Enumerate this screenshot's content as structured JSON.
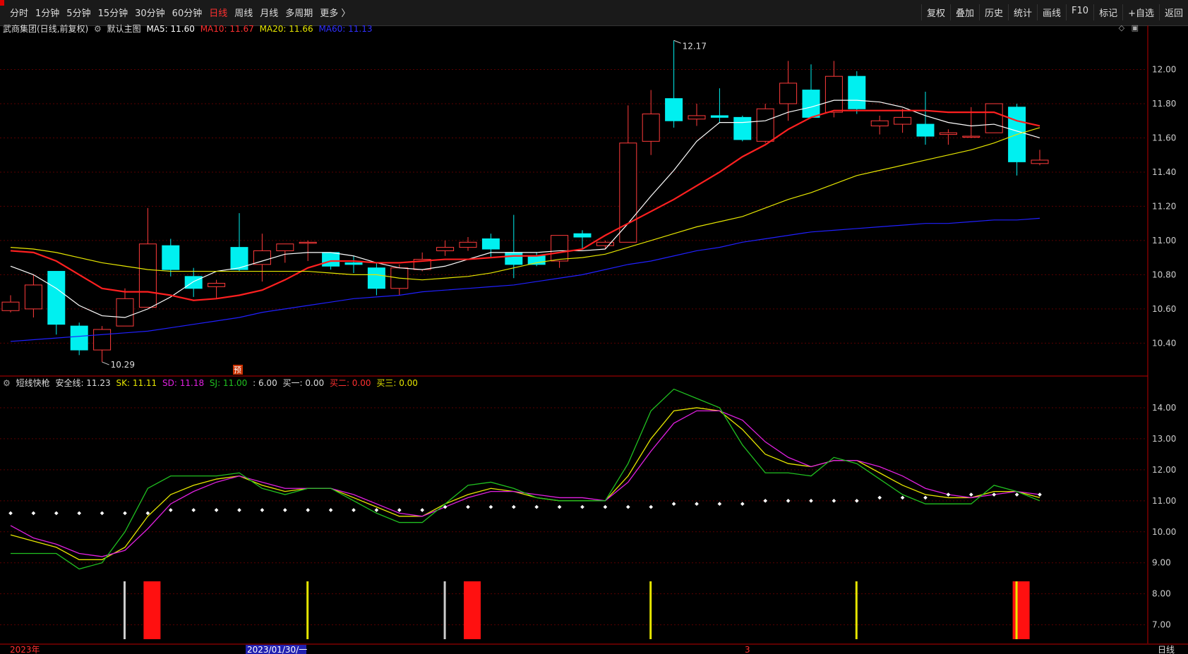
{
  "toolbar": {
    "periods": [
      {
        "label": "分时",
        "active": false
      },
      {
        "label": "1分钟",
        "active": false
      },
      {
        "label": "5分钟",
        "active": false
      },
      {
        "label": "15分钟",
        "active": false
      },
      {
        "label": "30分钟",
        "active": false
      },
      {
        "label": "60分钟",
        "active": false
      },
      {
        "label": "日线",
        "active": true
      },
      {
        "label": "周线",
        "active": false
      },
      {
        "label": "月线",
        "active": false
      },
      {
        "label": "多周期",
        "active": false
      },
      {
        "label": "更多 〉",
        "active": false
      }
    ],
    "tools": [
      "复权",
      "叠加",
      "历史",
      "统计",
      "画线",
      "F10",
      "标记",
      "+自选",
      "返回"
    ]
  },
  "main_header": {
    "stock": "武商集团(日线,前复权)",
    "chart_name": "默认主图",
    "ma5": "MA5: 11.60",
    "ma10": "MA10: 11.67",
    "ma20": "MA20: 11.66",
    "ma60": "MA60: 11.13"
  },
  "sub_header": {
    "indicator": "短线快枪",
    "safe": "安全线: 11.23",
    "sk": "SK: 11.11",
    "sd": "SD: 11.18",
    "sj": "SJ: 11.00",
    "extra": ": 6.00",
    "buy1": "买一: 0.00",
    "buy2": "买二: 0.00",
    "buy3": "买三: 0.00"
  },
  "colors": {
    "up": "#ff3b3b",
    "down": "#00f0f0",
    "ma5": "#ffffff",
    "ma10": "#ff2020",
    "ma20": "#e6e600",
    "ma60": "#2020ff",
    "sk": "#e6e600",
    "sd": "#e020e0",
    "sj": "#20c020"
  },
  "chart_data": [
    {
      "type": "candlestick",
      "title": "武商集团(日线,前复权)",
      "y_ticks": [
        10.4,
        10.6,
        10.8,
        11.0,
        11.2,
        11.4,
        11.6,
        11.8,
        12.0
      ],
      "ylim": [
        10.22,
        12.2
      ],
      "annotations": {
        "high": "12.17",
        "low": "10.29",
        "marker": "预"
      },
      "candles": [
        {
          "o": 10.59,
          "h": 10.68,
          "l": 10.58,
          "c": 10.64
        },
        {
          "o": 10.6,
          "h": 10.8,
          "l": 10.55,
          "c": 10.74
        },
        {
          "o": 10.82,
          "h": 10.82,
          "l": 10.45,
          "c": 10.51
        },
        {
          "o": 10.5,
          "h": 10.52,
          "l": 10.33,
          "c": 10.36
        },
        {
          "o": 10.36,
          "h": 10.5,
          "l": 10.29,
          "c": 10.48
        },
        {
          "o": 10.5,
          "h": 10.72,
          "l": 10.5,
          "c": 10.66
        },
        {
          "o": 10.61,
          "h": 11.19,
          "l": 10.61,
          "c": 10.98
        },
        {
          "o": 10.97,
          "h": 11.01,
          "l": 10.79,
          "c": 10.83
        },
        {
          "o": 10.79,
          "h": 10.84,
          "l": 10.67,
          "c": 10.72
        },
        {
          "o": 10.73,
          "h": 10.77,
          "l": 10.66,
          "c": 10.75
        },
        {
          "o": 10.96,
          "h": 11.16,
          "l": 10.82,
          "c": 10.83
        },
        {
          "o": 10.86,
          "h": 11.04,
          "l": 10.76,
          "c": 10.94
        },
        {
          "o": 10.94,
          "h": 10.98,
          "l": 10.87,
          "c": 10.98
        },
        {
          "o": 10.99,
          "h": 11.0,
          "l": 10.88,
          "c": 10.99
        },
        {
          "o": 10.93,
          "h": 10.93,
          "l": 10.83,
          "c": 10.85
        },
        {
          "o": 10.87,
          "h": 10.91,
          "l": 10.81,
          "c": 10.86
        },
        {
          "o": 10.84,
          "h": 10.87,
          "l": 10.68,
          "c": 10.72
        },
        {
          "o": 10.72,
          "h": 10.86,
          "l": 10.68,
          "c": 10.84
        },
        {
          "o": 10.83,
          "h": 10.93,
          "l": 10.82,
          "c": 10.89
        },
        {
          "o": 10.94,
          "h": 11.0,
          "l": 10.91,
          "c": 10.96
        },
        {
          "o": 10.96,
          "h": 11.02,
          "l": 10.94,
          "c": 10.99
        },
        {
          "o": 11.01,
          "h": 11.04,
          "l": 10.9,
          "c": 10.95
        },
        {
          "o": 10.93,
          "h": 11.15,
          "l": 10.78,
          "c": 10.86
        },
        {
          "o": 10.91,
          "h": 10.93,
          "l": 10.85,
          "c": 10.86
        },
        {
          "o": 10.88,
          "h": 11.03,
          "l": 10.84,
          "c": 11.03
        },
        {
          "o": 11.04,
          "h": 11.06,
          "l": 10.95,
          "c": 11.02
        },
        {
          "o": 10.97,
          "h": 11.0,
          "l": 10.95,
          "c": 10.99
        },
        {
          "o": 10.99,
          "h": 11.79,
          "l": 10.99,
          "c": 11.57
        },
        {
          "o": 11.58,
          "h": 11.88,
          "l": 11.5,
          "c": 11.74
        },
        {
          "o": 11.83,
          "h": 12.17,
          "l": 11.66,
          "c": 11.7
        },
        {
          "o": 11.71,
          "h": 11.8,
          "l": 11.67,
          "c": 11.73
        },
        {
          "o": 11.73,
          "h": 11.89,
          "l": 11.69,
          "c": 11.72
        },
        {
          "o": 11.72,
          "h": 11.73,
          "l": 11.58,
          "c": 11.59
        },
        {
          "o": 11.58,
          "h": 11.8,
          "l": 11.57,
          "c": 11.77
        },
        {
          "o": 11.8,
          "h": 12.05,
          "l": 11.7,
          "c": 11.92
        },
        {
          "o": 11.88,
          "h": 12.03,
          "l": 11.72,
          "c": 11.72
        },
        {
          "o": 11.75,
          "h": 12.05,
          "l": 11.72,
          "c": 11.96
        },
        {
          "o": 11.96,
          "h": 11.99,
          "l": 11.74,
          "c": 11.77
        },
        {
          "o": 11.67,
          "h": 11.73,
          "l": 11.62,
          "c": 11.7
        },
        {
          "o": 11.68,
          "h": 11.77,
          "l": 11.63,
          "c": 11.72
        },
        {
          "o": 11.68,
          "h": 11.87,
          "l": 11.56,
          "c": 11.61
        },
        {
          "o": 11.62,
          "h": 11.65,
          "l": 11.56,
          "c": 11.63
        },
        {
          "o": 11.61,
          "h": 11.78,
          "l": 11.6,
          "c": 11.61
        },
        {
          "o": 11.63,
          "h": 11.8,
          "l": 11.63,
          "c": 11.8
        },
        {
          "o": 11.78,
          "h": 11.8,
          "l": 11.38,
          "c": 11.46
        },
        {
          "o": 11.45,
          "h": 11.53,
          "l": 11.44,
          "c": 11.47
        }
      ],
      "series": [
        {
          "name": "MA5",
          "values": [
            10.85,
            10.8,
            10.72,
            10.62,
            10.56,
            10.55,
            10.6,
            10.67,
            10.76,
            10.82,
            10.84,
            10.88,
            10.92,
            10.93,
            10.93,
            10.91,
            10.87,
            10.84,
            10.83,
            10.85,
            10.89,
            10.93,
            10.93,
            10.93,
            10.94,
            10.94,
            10.95,
            11.1,
            11.26,
            11.41,
            11.58,
            11.69,
            11.69,
            11.7,
            11.75,
            11.78,
            11.82,
            11.82,
            11.81,
            11.78,
            11.73,
            11.69,
            11.67,
            11.68,
            11.64,
            11.6
          ]
        },
        {
          "name": "MA10",
          "values": [
            10.94,
            10.93,
            10.88,
            10.8,
            10.72,
            10.7,
            10.7,
            10.68,
            10.65,
            10.66,
            10.68,
            10.71,
            10.77,
            10.84,
            10.88,
            10.88,
            10.87,
            10.87,
            10.88,
            10.89,
            10.89,
            10.9,
            10.91,
            10.91,
            10.93,
            10.95,
            11.03,
            11.1,
            11.17,
            11.24,
            11.32,
            11.4,
            11.49,
            11.56,
            11.65,
            11.72,
            11.76,
            11.76,
            11.76,
            11.76,
            11.76,
            11.75,
            11.75,
            11.75,
            11.7,
            11.67
          ]
        },
        {
          "name": "MA20",
          "values": [
            10.96,
            10.95,
            10.93,
            10.9,
            10.87,
            10.85,
            10.83,
            10.82,
            10.82,
            10.82,
            10.82,
            10.82,
            10.82,
            10.82,
            10.81,
            10.8,
            10.8,
            10.78,
            10.77,
            10.78,
            10.79,
            10.81,
            10.84,
            10.87,
            10.89,
            10.9,
            10.92,
            10.96,
            11.0,
            11.04,
            11.08,
            11.11,
            11.14,
            11.19,
            11.24,
            11.28,
            11.33,
            11.38,
            11.41,
            11.44,
            11.47,
            11.5,
            11.53,
            11.57,
            11.62,
            11.66
          ]
        },
        {
          "name": "MA60",
          "values": [
            10.41,
            10.42,
            10.43,
            10.44,
            10.45,
            10.46,
            10.47,
            10.49,
            10.51,
            10.53,
            10.55,
            10.58,
            10.6,
            10.62,
            10.64,
            10.66,
            10.67,
            10.68,
            10.7,
            10.71,
            10.72,
            10.73,
            10.74,
            10.76,
            10.78,
            10.8,
            10.83,
            10.86,
            10.88,
            10.91,
            10.94,
            10.96,
            10.99,
            11.01,
            11.03,
            11.05,
            11.06,
            11.07,
            11.08,
            11.09,
            11.1,
            11.1,
            11.11,
            11.12,
            11.12,
            11.13
          ]
        }
      ]
    },
    {
      "type": "line",
      "title": "短线快枪",
      "y_ticks": [
        7.0,
        8.0,
        9.0,
        10.0,
        11.0,
        12.0,
        13.0,
        14.0
      ],
      "ylim": [
        6.4,
        15.0
      ],
      "series": [
        {
          "name": "SK",
          "values": [
            9.9,
            9.7,
            9.5,
            9.1,
            9.1,
            9.5,
            10.5,
            11.2,
            11.5,
            11.7,
            11.8,
            11.5,
            11.3,
            11.4,
            11.4,
            11.1,
            10.8,
            10.5,
            10.5,
            10.9,
            11.2,
            11.4,
            11.3,
            11.1,
            11.0,
            11.0,
            11.0,
            11.8,
            13.0,
            13.9,
            14.0,
            13.9,
            13.3,
            12.5,
            12.2,
            12.1,
            12.3,
            12.3,
            11.9,
            11.5,
            11.2,
            11.1,
            11.1,
            11.3,
            11.3,
            11.1
          ]
        },
        {
          "name": "SD",
          "values": [
            10.2,
            9.8,
            9.6,
            9.3,
            9.2,
            9.4,
            10.1,
            10.9,
            11.3,
            11.6,
            11.8,
            11.6,
            11.4,
            11.4,
            11.4,
            11.2,
            10.9,
            10.6,
            10.5,
            10.8,
            11.1,
            11.3,
            11.3,
            11.2,
            11.1,
            11.1,
            11.0,
            11.6,
            12.6,
            13.5,
            13.9,
            13.9,
            13.6,
            12.9,
            12.4,
            12.1,
            12.3,
            12.3,
            12.1,
            11.8,
            11.4,
            11.2,
            11.1,
            11.2,
            11.3,
            11.2
          ]
        },
        {
          "name": "SJ",
          "values": [
            9.3,
            9.3,
            9.3,
            8.8,
            9.0,
            10.0,
            11.4,
            11.8,
            11.8,
            11.8,
            11.9,
            11.4,
            11.2,
            11.4,
            11.4,
            11.0,
            10.6,
            10.3,
            10.3,
            10.9,
            11.5,
            11.6,
            11.4,
            11.1,
            11.0,
            11.0,
            11.0,
            12.2,
            13.9,
            14.6,
            14.3,
            14.0,
            12.8,
            11.9,
            11.9,
            11.8,
            12.4,
            12.2,
            11.7,
            11.2,
            10.9,
            10.9,
            10.9,
            11.5,
            11.3,
            11.0
          ]
        },
        {
          "name": "安全线",
          "values": [
            10.6,
            10.6,
            10.6,
            10.6,
            10.6,
            10.6,
            10.6,
            10.7,
            10.7,
            10.7,
            10.7,
            10.7,
            10.7,
            10.7,
            10.7,
            10.7,
            10.7,
            10.7,
            10.7,
            10.8,
            10.8,
            10.8,
            10.8,
            10.8,
            10.8,
            10.8,
            10.8,
            10.8,
            10.8,
            10.9,
            10.9,
            10.9,
            10.9,
            11.0,
            11.0,
            11.0,
            11.0,
            11.0,
            11.1,
            11.1,
            11.1,
            11.2,
            11.2,
            11.2,
            11.2,
            11.2
          ]
        }
      ],
      "signal_bars": [
        {
          "index": 5,
          "color": "#cccccc",
          "width": "thin"
        },
        {
          "index": 6,
          "color": "#ff1010",
          "width": "wide"
        },
        {
          "index": 13,
          "color": "#e6e600",
          "width": "thin"
        },
        {
          "index": 19,
          "color": "#cccccc",
          "width": "thin"
        },
        {
          "index": 20,
          "color": "#ff1010",
          "width": "wide"
        },
        {
          "index": 28,
          "color": "#e6e600",
          "width": "thin"
        },
        {
          "index": 37,
          "color": "#e6e600",
          "width": "thin"
        },
        {
          "index": 44,
          "color": "#ff1010",
          "width": "wide"
        },
        {
          "index": 44,
          "color": "#e6e600",
          "width": "thin"
        }
      ]
    }
  ],
  "xaxis": {
    "label_left": "2023年",
    "label_cursor": "2023/01/30/一",
    "label_mid": "3",
    "label_right": "日线"
  }
}
